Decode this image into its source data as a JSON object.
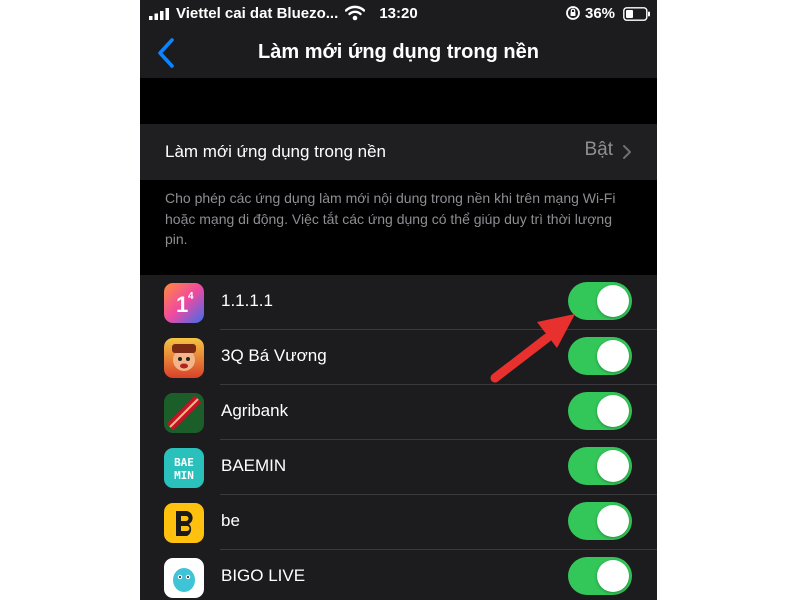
{
  "status_bar": {
    "carrier": "Viettel cai dat Bluezo...",
    "time": "13:20",
    "battery": "36%"
  },
  "nav": {
    "title": "Làm mới ứng dụng trong nền"
  },
  "refresh_setting": {
    "label": "Làm mới ứng dụng trong nền",
    "value": "Bật"
  },
  "description": "Cho phép các ứng dụng làm mới nội dung trong nền khi trên mạng Wi-Fi hoặc mạng di động. Việc tắt các ứng dụng có thể giúp duy trì thời lượng pin.",
  "apps": [
    {
      "name": "1.1.1.1",
      "icon": "cloudflare-1111-icon",
      "enabled": true
    },
    {
      "name": "3Q Bá Vương",
      "icon": "3q-ba-vuong-icon",
      "enabled": true
    },
    {
      "name": "Agribank",
      "icon": "agribank-icon",
      "enabled": true
    },
    {
      "name": "BAEMIN",
      "icon": "baemin-icon",
      "enabled": true,
      "icon_text": "BAE MIN"
    },
    {
      "name": "be",
      "icon": "be-icon",
      "enabled": true
    },
    {
      "name": "BIGO LIVE",
      "icon": "bigo-live-icon",
      "enabled": true
    }
  ],
  "colors": {
    "background": "#1c1c1e",
    "toggle_on": "#33c759",
    "accent_blue": "#0a84ff",
    "annotation_arrow": "#e8312f"
  }
}
